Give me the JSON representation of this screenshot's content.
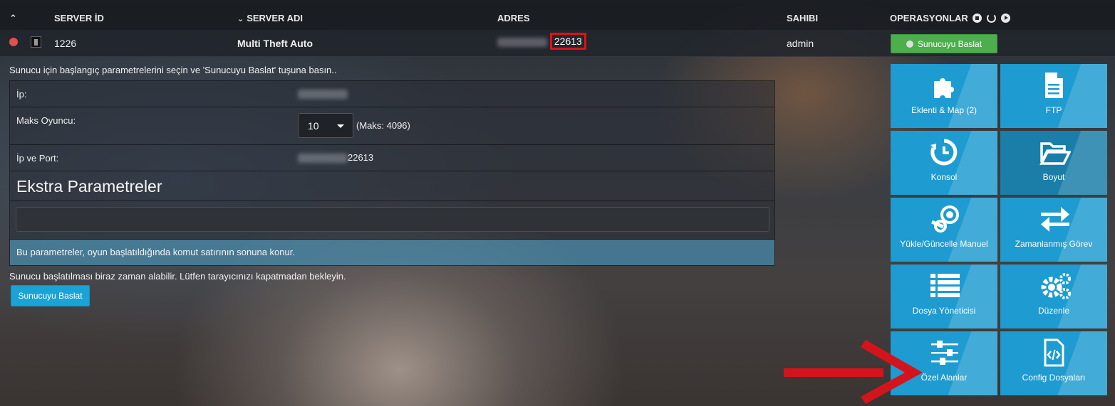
{
  "header": {
    "server_id": "SERVER İD",
    "server_adi": "SERVER ADI",
    "adres": "ADRES",
    "sahibi": "SAHIBI",
    "operasyonlar": "OPERASYONLAR"
  },
  "server": {
    "id": "1226",
    "name": "Multi Theft Auto",
    "port": "22613",
    "owner": "admin",
    "start_label": "Sunucuyu Baslat"
  },
  "params": {
    "intro": "Sunucu için başlangıç parametrelerini seçin ve 'Sunucuyu Baslat' tuşuna basın..",
    "ip_label": "İp:",
    "max_players_label": "Maks Oyuncu:",
    "max_players_value": "10",
    "max_players_limit": "(Maks: 4096)",
    "ip_port_label": "İp ve Port:",
    "ip_port_port": "22613",
    "extra_title": "Ekstra Parametreler",
    "extra_value": "",
    "help": "Bu parametreler, oyun başlatıldığında komut satırının sonuna konur.",
    "note": "Sunucu başlatılması biraz zaman alabilir. Lütfen tarayıcınızı kapatmadan bekleyin.",
    "start_label": "Sunucuyu Baslat"
  },
  "tiles": [
    {
      "label": "Eklenti & Map (2)",
      "icon": "puzzle-icon"
    },
    {
      "label": "FTP",
      "icon": "file-icon"
    },
    {
      "label": "Konsol",
      "icon": "history-icon"
    },
    {
      "label": "Boyut",
      "icon": "folder-open-icon"
    },
    {
      "label": "Yükle/Güncelle Manuel",
      "icon": "steam-icon"
    },
    {
      "label": "Zamanlanmış Görev",
      "icon": "exchange-icon"
    },
    {
      "label": "Dosya Yöneticisi",
      "icon": "list-icon"
    },
    {
      "label": "Düzenle",
      "icon": "gears-icon"
    },
    {
      "label": "Özel Alanlar",
      "icon": "sliders-icon"
    },
    {
      "label": "Config Dosyaları",
      "icon": "code-file-icon"
    }
  ],
  "colors": {
    "tile": "#1e9bd0",
    "start_green": "#4cae4c",
    "status_red": "#e05050",
    "highlight": "#e0101a"
  }
}
